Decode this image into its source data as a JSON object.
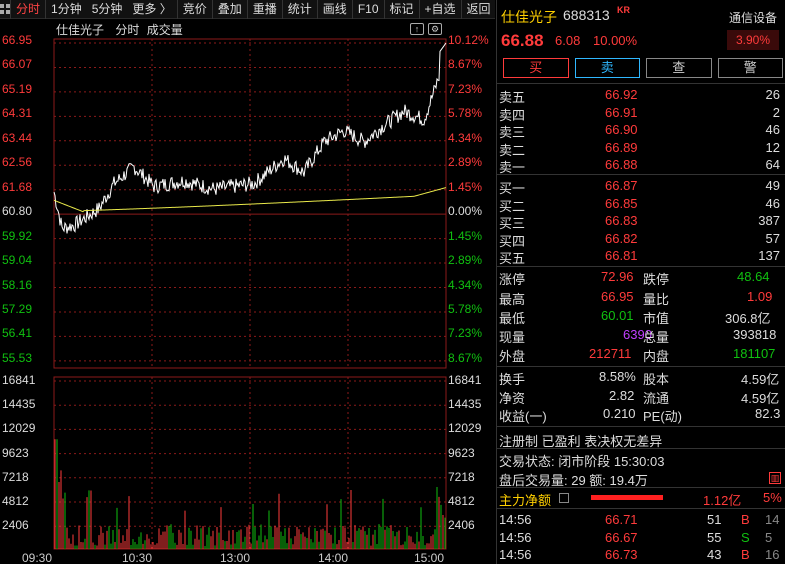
{
  "toolbar": {
    "tabs": [
      "分时",
      "1分钟",
      "5分钟",
      "更多 〉",
      "竞价",
      "叠加",
      "重播",
      "统计",
      "画线",
      "F10",
      "标记",
      "+自选",
      "返回"
    ]
  },
  "chart": {
    "stock_name": "仕佳光子",
    "mode_label": "分时",
    "volume_label": "成交量",
    "price_axis_left": [
      "66.95",
      "66.07",
      "65.19",
      "64.31",
      "63.44",
      "62.56",
      "61.68",
      "60.80",
      "59.92",
      "59.04",
      "58.16",
      "57.29",
      "56.41",
      "55.53"
    ],
    "price_axis_right": [
      "10.12%",
      "8.67%",
      "7.23%",
      "5.78%",
      "4.34%",
      "2.89%",
      "1.45%",
      "0.00%",
      "1.45%",
      "2.89%",
      "4.34%",
      "5.78%",
      "7.23%",
      "8.67%"
    ],
    "volume_axis_left": [
      "16841",
      "14435",
      "12029",
      "9623",
      "7218",
      "4812",
      "2406"
    ],
    "volume_axis_right": [
      "16841",
      "14435",
      "12029",
      "9623",
      "7218",
      "4812",
      "2406"
    ],
    "time_labels": [
      "09:30",
      "10:30",
      "13:00",
      "14:00",
      "15:00"
    ],
    "colors": {
      "up": "#ff3b3b",
      "down": "#10c010",
      "price_line": "#ffffff",
      "avg_line": "#e8e84a",
      "grid": "#8b1a1a"
    }
  },
  "quote": {
    "name": "仕佳光子",
    "code": "688313",
    "badge": "KR",
    "sector": "通信设备",
    "sector_change": "3.90%",
    "price": "66.88",
    "change": "6.08",
    "change_pct": "10.00%"
  },
  "actions": [
    "买",
    "卖",
    "查",
    "警"
  ],
  "order_book": {
    "asks": [
      {
        "label": "卖五",
        "price": "66.92",
        "vol": "26"
      },
      {
        "label": "卖四",
        "price": "66.91",
        "vol": "2"
      },
      {
        "label": "卖三",
        "price": "66.90",
        "vol": "46"
      },
      {
        "label": "卖二",
        "price": "66.89",
        "vol": "12"
      },
      {
        "label": "卖一",
        "price": "66.88",
        "vol": "64"
      }
    ],
    "bids": [
      {
        "label": "买一",
        "price": "66.87",
        "vol": "49"
      },
      {
        "label": "买二",
        "price": "66.85",
        "vol": "46"
      },
      {
        "label": "买三",
        "price": "66.83",
        "vol": "387"
      },
      {
        "label": "买四",
        "price": "66.82",
        "vol": "57"
      },
      {
        "label": "买五",
        "price": "66.81",
        "vol": "137"
      }
    ]
  },
  "stats": {
    "limit_up_label": "涨停",
    "limit_up": "72.96",
    "limit_down_label": "跌停",
    "limit_down": "48.64",
    "high_label": "最高",
    "high": "66.95",
    "vol_ratio_label": "量比",
    "vol_ratio": "1.09",
    "low_label": "最低",
    "low": "60.01",
    "mkt_cap_label": "市值",
    "mkt_cap": "306.8亿",
    "last_vol_label": "现量",
    "last_vol": "6390",
    "total_vol_label": "总量",
    "total_vol": "393818",
    "outer_label": "外盘",
    "outer": "212711",
    "inner_label": "内盘",
    "inner": "181107",
    "turnover_label": "换手",
    "turnover": "8.58%",
    "share_cap_label": "股本",
    "share_cap": "4.59亿",
    "nav_label": "净资",
    "nav": "2.82",
    "float_label": "流通",
    "float": "4.59亿",
    "eps_label": "收益(一)",
    "eps": "0.210",
    "pe_label": "PE(动)",
    "pe": "82.3"
  },
  "tags": "注册制 已盈利 表决权无差异",
  "trade_status": "交易状态: 闭市阶段 15:30:03",
  "after_hours": "盘后交易量: 29  额: 19.4万",
  "net_inflow": {
    "label": "主力净额",
    "value": "1.12亿",
    "pct": "5%"
  },
  "ticks": [
    {
      "time": "14:56",
      "price": "66.71",
      "vol": "51",
      "side": "B",
      "count": "14"
    },
    {
      "time": "14:56",
      "price": "66.67",
      "vol": "55",
      "side": "S",
      "count": "5"
    },
    {
      "time": "14:56",
      "price": "66.73",
      "vol": "43",
      "side": "B",
      "count": "16"
    }
  ]
}
